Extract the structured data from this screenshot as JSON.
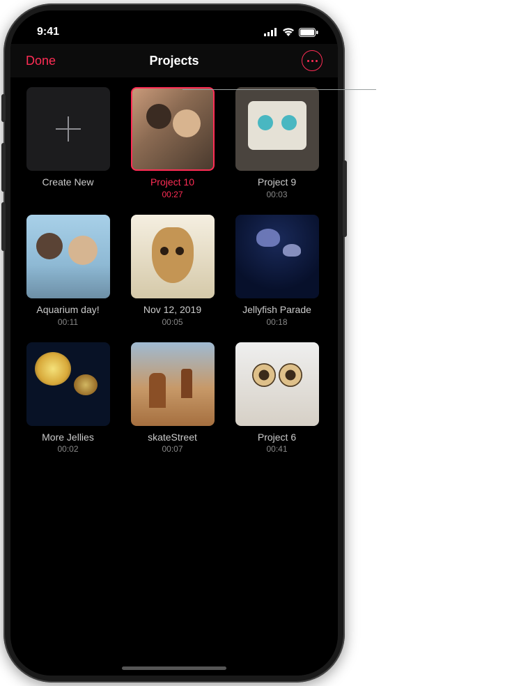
{
  "status": {
    "time": "9:41"
  },
  "nav": {
    "done_label": "Done",
    "title": "Projects",
    "more_icon": "more-icon"
  },
  "create_new_label": "Create New",
  "projects": [
    {
      "name": "Project 10",
      "duration": "00:27",
      "selected": true,
      "thumb_class": "th1"
    },
    {
      "name": "Project 9",
      "duration": "00:03",
      "selected": false,
      "thumb_class": "th2"
    },
    {
      "name": "Aquarium day!",
      "duration": "00:11",
      "selected": false,
      "thumb_class": "th3"
    },
    {
      "name": "Nov 12, 2019",
      "duration": "00:05",
      "selected": false,
      "thumb_class": "th4"
    },
    {
      "name": "Jellyfish Parade",
      "duration": "00:18",
      "selected": false,
      "thumb_class": "th5"
    },
    {
      "name": "More Jellies",
      "duration": "00:02",
      "selected": false,
      "thumb_class": "th6"
    },
    {
      "name": "skateStreet",
      "duration": "00:07",
      "selected": false,
      "thumb_class": "th7"
    },
    {
      "name": "Project 6",
      "duration": "00:41",
      "selected": false,
      "thumb_class": "th8"
    }
  ]
}
